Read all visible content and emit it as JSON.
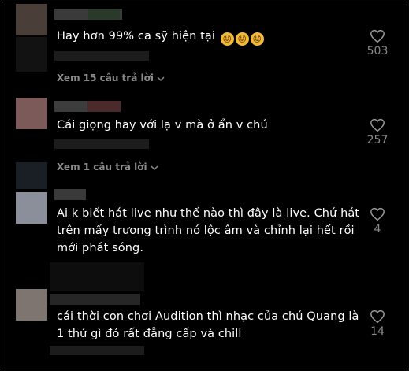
{
  "comments": [
    {
      "text": "Hay hơn 99% ca sỹ hiện tại",
      "emoji": [
        "😟",
        "😟",
        "😟"
      ],
      "likes": "503",
      "replies": "Xem 15 câu trả lời",
      "avatar_color": "#4a3f38"
    },
    {
      "text": "Cái giọng hay với lạ v mà ở ẩn v chú",
      "likes": "257",
      "replies": "Xem 1 câu trả lời",
      "avatar_color": "#7d5a5a"
    },
    {
      "lines": [
        "Ai k biết hát live như thế nào thì đây là live. Chứ hát",
        "trên mấy trương trình nó lộc âm và chỉnh lại hết rồi",
        "mới phát sóng."
      ],
      "likes": "4",
      "avatar_color": "#8a8f9a"
    },
    {
      "lines": [
        "cái thời con chơi Audition thì nhạc của chú Quang là",
        "1 thứ gì đó rất đẳng cấp và chill"
      ],
      "likes": "14",
      "avatar_color": "#7e7470"
    }
  ],
  "icons": {
    "like": "heart-outline-icon",
    "expand": "chevron-down-icon",
    "emoji": "worried-face-icon"
  }
}
